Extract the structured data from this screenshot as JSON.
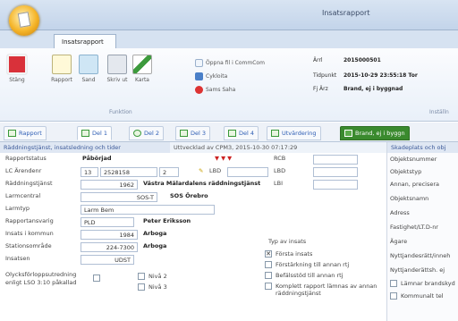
{
  "window": {
    "title": "Insatsrapport"
  },
  "ribbon": {
    "tab_label": "Insatsrapport",
    "buttons": [
      {
        "label": "Stäng"
      },
      {
        "label": "Rapport"
      },
      {
        "label": "Sand"
      },
      {
        "label": "Skriv ut"
      },
      {
        "label": "Karta"
      }
    ],
    "group_label": "Funktion",
    "small_items": [
      {
        "label": "Öppna fil i CommCom"
      },
      {
        "label": "Cykloita"
      },
      {
        "label": "Sams Saha"
      }
    ],
    "info": [
      {
        "key": "Ärrl",
        "value": "2015000501"
      },
      {
        "key": "Tidpunkt",
        "value": "2015-10-29 23:55:18 Tor"
      },
      {
        "key": "Fj Ärz",
        "value": "Brand, ej i byggnad"
      }
    ],
    "right_group": "Inställn"
  },
  "form_tabs": [
    {
      "label": "Rapport"
    },
    {
      "label": "Del 1"
    },
    {
      "label": "Del 2"
    },
    {
      "label": "Del 3"
    },
    {
      "label": "Del 4"
    },
    {
      "label": "Utvärdering"
    },
    {
      "label": "Brand, ej i byggn"
    }
  ],
  "section": {
    "left_title": "Räddningstjänst, insatsledning och tider",
    "timestamp": "Uttvecklad av CPM3, 2015-10-30 07:17:29",
    "right_title": "Skadeplats och obj"
  },
  "fields": {
    "rapportstatus": {
      "label": "Rapportstatus",
      "value": "Påbörjad"
    },
    "lc_arende": {
      "label": "LC Ärendenr",
      "a": "13",
      "b": "2528158",
      "c": "2"
    },
    "rcb": {
      "label": "RCB"
    },
    "lbd": {
      "label": "LBD"
    },
    "lbi": {
      "label": "LBI"
    },
    "raddningstjanst": {
      "label": "Räddningstjänst",
      "code": "1962",
      "name": "Västra Mälardalens räddningstjänst"
    },
    "larmcentral": {
      "label": "Larmcentral",
      "code": "SOS-T",
      "name": "SOS Örebro"
    },
    "larmtyp": {
      "label": "Larmtyp",
      "value": "Larm Bem"
    },
    "rapportansvarig": {
      "label": "Rapportansvarig",
      "code": "PLD",
      "name": "Peter Eriksson"
    },
    "insatsomrade": {
      "label": "Insats i kommun",
      "code": "1984",
      "name": "Arboga"
    },
    "stationsomrade": {
      "label": "Stationsområde",
      "code": "224-7300",
      "name": "Arboga"
    },
    "insatsen": {
      "label": "Insatsen",
      "value": "UDST"
    },
    "olycksforlopp": {
      "label": "Olycksförloppsutredning enligt LSO 3:10 påkallad"
    },
    "niva2": {
      "label": "Nivå 2"
    },
    "niva3": {
      "label": "Nivå 3"
    }
  },
  "insats": {
    "heading": "Typ av insats",
    "items": [
      {
        "label": "Första insats",
        "checked": true
      },
      {
        "label": "Förstärkning till annan rtj",
        "checked": false
      },
      {
        "label": "Befälsstöd till annan rtj",
        "checked": false
      },
      {
        "label": "Komplett rapport lämnas av annan räddningstjänst",
        "checked": false
      }
    ]
  },
  "right_labels": [
    "Objektsnummer",
    "Objektstyp",
    "Annan, precisera",
    "Objektsnamn",
    "Adress",
    "Fastighet/LT.D-nr",
    "Ägare",
    "Nyttjandesrätt/inneh",
    "Nyttjanderättsh. ej",
    "Lämnar brandskyd",
    "Kommunalt tel"
  ],
  "colors": {
    "accent": "#2d5db4",
    "active_tab": "#3a8a2e",
    "label_blue": "#3b5998"
  }
}
